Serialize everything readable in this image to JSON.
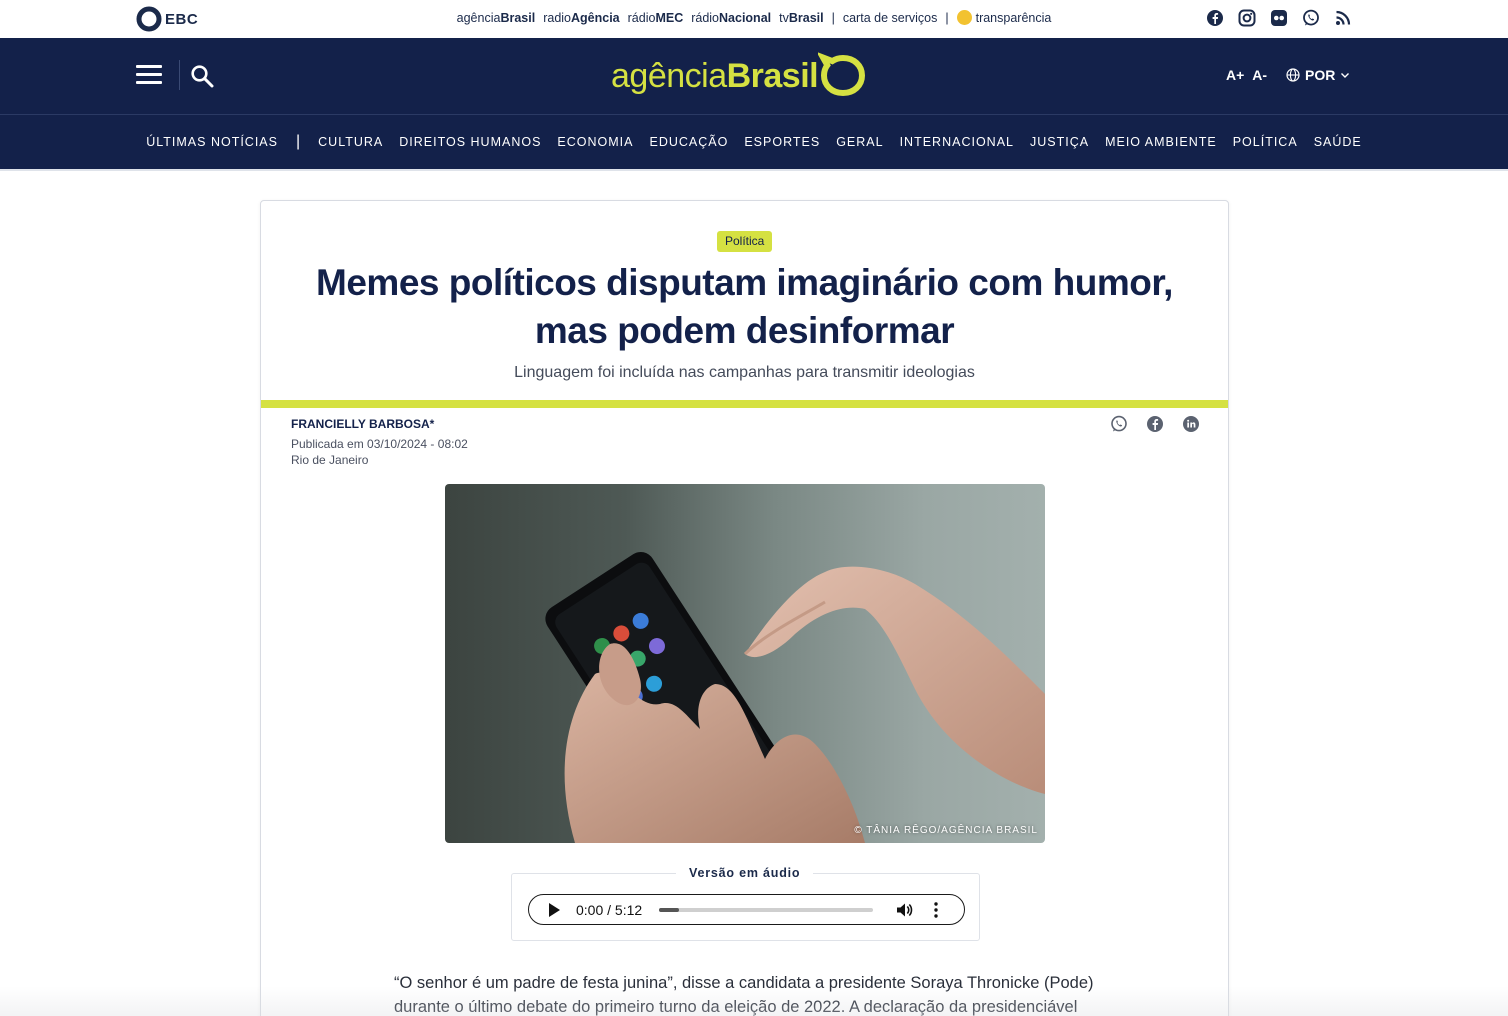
{
  "topbar": {
    "ebc_logo": "EBC",
    "links": [
      {
        "light": "agência",
        "bold": "Brasil"
      },
      {
        "light": "radio",
        "bold": "Agência"
      },
      {
        "light": "rádio",
        "bold": "MEC"
      },
      {
        "light": "rádio",
        "bold": "Nacional"
      },
      {
        "light": "tv",
        "bold": "Brasil"
      }
    ],
    "services": "carta de serviços",
    "transparency": "transparência",
    "social_icons": [
      "facebook-icon",
      "instagram-icon",
      "flickr-icon",
      "whatsapp-icon",
      "rss-icon"
    ]
  },
  "header": {
    "brand_light": "agência",
    "brand_bold": "Brasil",
    "font_increase": "A+",
    "font_decrease": "A-",
    "language": "POR"
  },
  "categories": {
    "latest": "Últimas notícias",
    "divider": "|",
    "items": [
      "Cultura",
      "Direitos Humanos",
      "Economia",
      "Educação",
      "Esportes",
      "Geral",
      "Internacional",
      "Justiça",
      "Meio Ambiente",
      "Política",
      "Saúde"
    ]
  },
  "article": {
    "category": "Política",
    "title_line1": "Memes políticos disputam imaginário com humor,",
    "title_line2": "mas podem desinformar",
    "subtitle": "Linguagem foi incluída nas campanhas para transmitir ideologias",
    "author": "FRANCIELLY BARBOSA*",
    "published": "Publicada em 03/10/2024 - 08:02",
    "location": "Rio de Janeiro",
    "share_icons": [
      "whatsapp-icon",
      "facebook-icon",
      "linkedin-icon"
    ],
    "photo_credit": "© TÂNIA RÊGO/AGÊNCIA BRASIL",
    "audio": {
      "label": "Versão em áudio",
      "time": "0:00 / 5:12",
      "progress": 0.0
    },
    "body_line1": "“O senhor é um padre de festa junina”, disse a candidata a presidente Soraya Thronicke (Pode)",
    "body_line2": "durante o último debate do primeiro turno da eleição de 2022. A declaração da presidenciável"
  },
  "colors": {
    "navy": "#13214a",
    "accent": "#d5e142"
  }
}
